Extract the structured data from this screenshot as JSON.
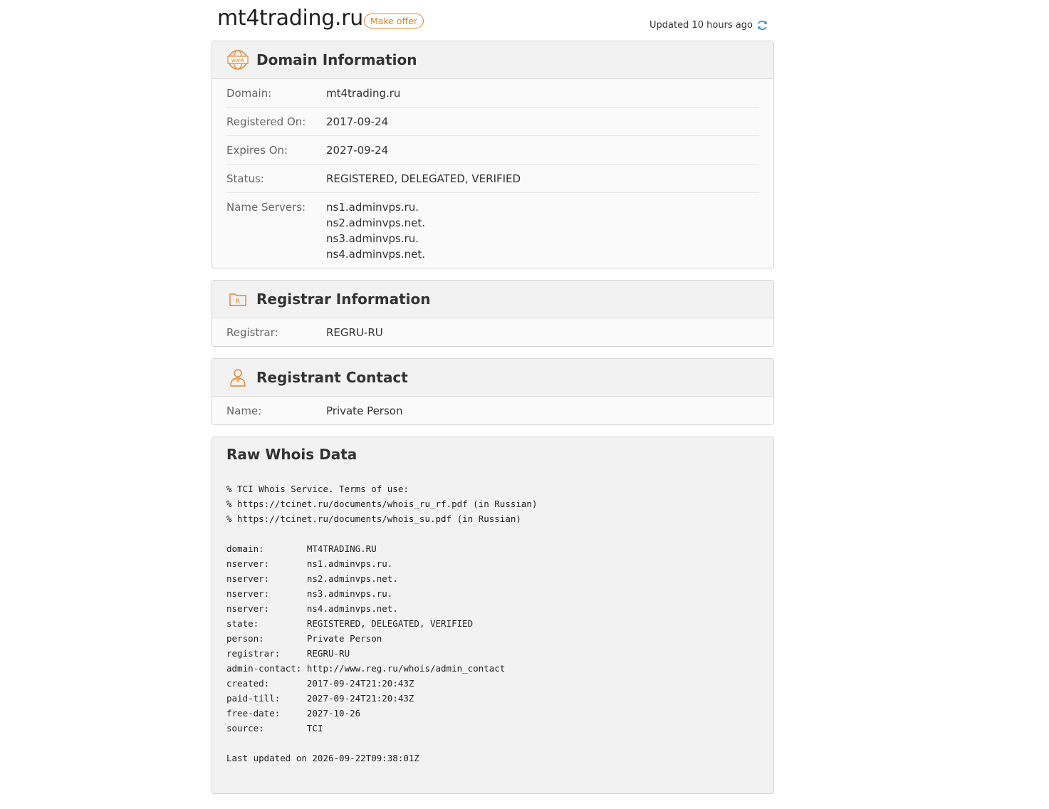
{
  "header": {
    "domain": "mt4trading.ru",
    "make_offer": "Make offer",
    "updated": "Updated 10 hours ago",
    "refresh_icon": "refresh-icon"
  },
  "domain_info": {
    "title": "Domain Information",
    "icon": "www-icon",
    "rows": [
      {
        "label": "Domain:",
        "value": "mt4trading.ru"
      },
      {
        "label": "Registered On:",
        "value": "2017-09-24"
      },
      {
        "label": "Expires On:",
        "value": "2027-09-24"
      },
      {
        "label": "Status:",
        "value": "REGISTERED, DELEGATED, VERIFIED"
      }
    ],
    "name_servers_label": "Name Servers:",
    "name_servers": [
      "ns1.adminvps.ru.",
      "ns2.adminvps.net.",
      "ns3.adminvps.ru.",
      "ns4.adminvps.net."
    ]
  },
  "registrar_info": {
    "title": "Registrar Information",
    "icon": "registrar-folder-icon",
    "icon_letter": "R",
    "rows": [
      {
        "label": "Registrar:",
        "value": "REGRU-RU"
      }
    ]
  },
  "registrant_contact": {
    "title": "Registrant Contact",
    "icon": "person-icon",
    "rows": [
      {
        "label": "Name:",
        "value": "Private Person"
      }
    ]
  },
  "raw_whois": {
    "title": "Raw Whois Data",
    "text": "% TCI Whois Service. Terms of use:\n% https://tcinet.ru/documents/whois_ru_rf.pdf (in Russian)\n% https://tcinet.ru/documents/whois_su.pdf (in Russian)\n\ndomain:        MT4TRADING.RU\nnserver:       ns1.adminvps.ru.\nnserver:       ns2.adminvps.net.\nnserver:       ns3.adminvps.ru.\nnserver:       ns4.adminvps.net.\nstate:         REGISTERED, DELEGATED, VERIFIED\nperson:        Private Person\nregistrar:     REGRU-RU\nadmin-contact: http://www.reg.ru/whois/admin_contact\ncreated:       2017-09-24T21:20:43Z\npaid-till:     2027-09-24T21:20:43Z\nfree-date:     2027-10-26\nsource:        TCI\n\nLast updated on 2026-09-22T09:38:01Z"
  },
  "colors": {
    "accent": "#e8822a",
    "refresh": "#3a8fd8"
  }
}
